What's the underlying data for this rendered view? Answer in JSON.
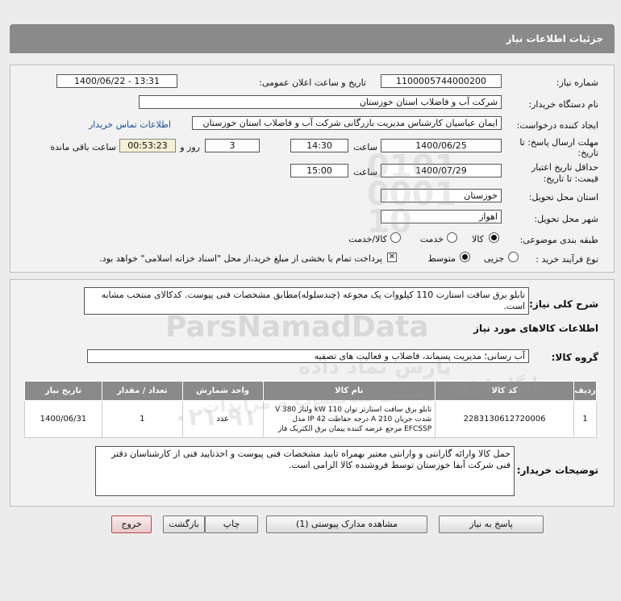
{
  "page_title": "جزئیات اطلاعات نیاز",
  "form": {
    "need_number_label": "شماره نیاز:",
    "need_number": "1100005744000200",
    "announce_label": "تاریخ و ساعت اعلان عمومی:",
    "announce_value": "1400/06/22 - 13:31",
    "buyer_org_label": "نام دستگاه خریدار:",
    "buyer_org": "شرکت آب و فاضلاب استان خوزستان",
    "creator_label": "ایجاد کننده درخواست:",
    "creator": "ایمان عباسیان کارشناس مدیریت بازرگانی شرکت آب و فاضلاب استان خوزستان",
    "contact_link": "اطلاعات تماس خریدار",
    "deadline_label_1": "مهلت ارسال پاسخ: تا",
    "deadline_label_2": "تاریخ:",
    "deadline_date": "1400/06/25",
    "time_label": "ساعت",
    "deadline_time": "14:30",
    "days_value": "3",
    "days_label": "روز و",
    "remaining_time": "00:53:23",
    "remaining_label": "ساعت باقی مانده",
    "validity_label_1": "حداقل تاریخ اعتبار",
    "validity_label_2": "قیمت: تا تاریخ:",
    "validity_date": "1400/07/29",
    "validity_time": "15:00",
    "province_label": "استان محل تحویل:",
    "province": "خوزستان",
    "city_label": "شهر محل تحویل:",
    "city": "اهواز",
    "category_label": "طبقه بندی موضوعی:",
    "category_options": [
      "کالا",
      "خدمت",
      "کالا/خدمت"
    ],
    "process_label": "نوع فرآیند خرید :",
    "process_options": [
      "جزیی",
      "متوسط"
    ],
    "payment_note": "پرداخت تمام یا بخشی از مبلغ خرید،از محل \"اسناد خزانه اسلامی\" خواهد بود."
  },
  "summary": {
    "label": "شرح کلی نیاز:",
    "text": "تابلو برق سافت استارت 110 کیلووات یک مجوعه (چندسلوله)مطابق مشخصات فنی پیوست. کدکالای منتخب مشابه است."
  },
  "goods": {
    "section_title": "اطلاعات کالاهای مورد نیاز",
    "group_label": "گروه کالا:",
    "group_value": "آب رسانی؛ مدیریت پسماند، فاضلاب و فعالیت های تصفیه",
    "columns": [
      "ردیف",
      "کد کالا",
      "نام کالا",
      "واحد شمارش",
      "تعداد / مقدار",
      "تاریخ نیاز"
    ],
    "rows": [
      {
        "row": "1",
        "code": "2283130612720006",
        "name": "تابلو برق سافت استارتر توان 110 kW ولتاژ 380 V شدت جریان 210 A درجه حفاظت IP 42 مدل EFCSSP مرجع عرضه کننده پیمان برق الکتریک فاز",
        "unit": "عدد",
        "qty": "1",
        "date": "1400/06/31"
      }
    ]
  },
  "buyer_notes": {
    "label": "توضیحات خریدار:",
    "text": "حمل کالا وارائه گارانتی و وارانتی معتبر بهمراه تایید مشخصات فنی پیوست و اخذتایید فنی از کارشناسان دفتر فنی شرکت آبفا خوزستان توسط فروشنده کالا الزامی است."
  },
  "buttons": {
    "reply": "پاسخ به نیاز",
    "attachments": "مشاهده مدارک پیوستی (1)",
    "print": "چاپ",
    "back": "بازگشت",
    "exit": "خروج"
  },
  "watermark": {
    "brand": "ParsNamadData",
    "code": "0101 0001 10",
    "persian_1": "پارس نماد داده",
    "persian_2": "پایگاه اطلاع رسانی مناقصات و مزایدات",
    "phone": "۰۲۱-۹۱"
  },
  "colors": {
    "titlebar": "#8a8a8a",
    "link": "#1b4f9c",
    "remaining_bg": "#f4f0d4",
    "exit_border": "#c04646"
  }
}
